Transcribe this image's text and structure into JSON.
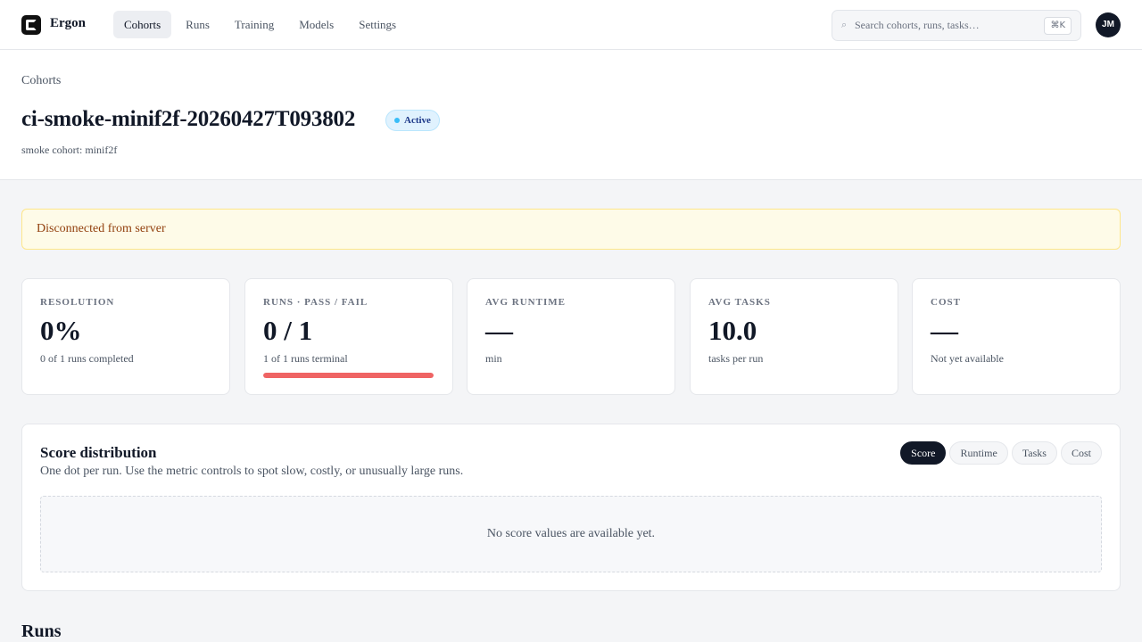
{
  "app": {
    "brand": "Ergon",
    "avatar_initials": "JM"
  },
  "nav": {
    "items": [
      {
        "label": "Cohorts",
        "active": true
      },
      {
        "label": "Runs"
      },
      {
        "label": "Training"
      },
      {
        "label": "Models"
      },
      {
        "label": "Settings"
      }
    ]
  },
  "search": {
    "placeholder": "Search cohorts, runs, tasks…",
    "shortcut": "⌘K"
  },
  "header": {
    "breadcrumb": "Cohorts",
    "title": "ci-smoke-minif2f-20260427T093802",
    "status": "Active",
    "subtitle": "smoke cohort: minif2f"
  },
  "alert": {
    "message": "Disconnected from server"
  },
  "stats": [
    {
      "label": "RESOLUTION",
      "value": "0%",
      "sub": "0 of 1 runs completed"
    },
    {
      "label": "RUNS · PASS / FAIL",
      "value": "0 / 1",
      "sub": "1 of 1 runs terminal",
      "progress_fail_fraction": 1.0
    },
    {
      "label": "AVG RUNTIME",
      "value": "—",
      "sub": "min"
    },
    {
      "label": "AVG TASKS",
      "value": "10.0",
      "sub": "tasks per run"
    },
    {
      "label": "COST",
      "value": "—",
      "sub": "Not yet available"
    }
  ],
  "score_panel": {
    "title": "Score distribution",
    "description": "One dot per run. Use the metric controls to spot slow, costly, or unusually large runs.",
    "metrics": [
      "Score",
      "Runtime",
      "Tasks",
      "Cost"
    ],
    "selected_metric": "Score",
    "empty_message": "No score values are available yet."
  },
  "runs_section": {
    "title": "Runs"
  },
  "colors": {
    "accent": "#111827",
    "alert_bg": "#fefbe8",
    "fail": "#ef6464",
    "badge_bg": "#e0f2fe"
  }
}
